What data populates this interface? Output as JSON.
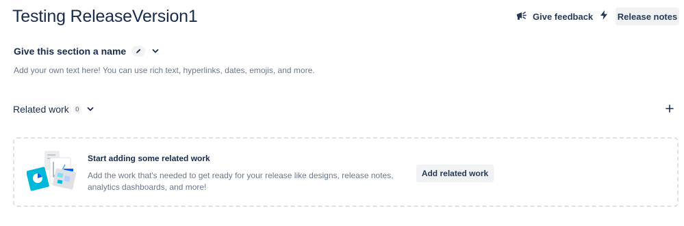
{
  "header": {
    "title": "Testing ReleaseVersion1",
    "feedback_label": "Give feedback",
    "release_notes_label": "Release notes"
  },
  "custom_section": {
    "name": "Give this section a name",
    "description": "Add your own text here! You can use rich text, hyperlinks, dates, emojis, and more."
  },
  "related_work": {
    "title": "Related work",
    "count": "0",
    "empty_title": "Start adding some related work",
    "empty_body": "Add the work that's needed to get ready for your release like designs, release notes, analytics dashboards, and more!",
    "add_label": "Add related work"
  },
  "icons": {
    "feedback": "megaphone-icon",
    "bolt": "lightning-bolt-icon",
    "edit": "pencil-icon",
    "chevron": "chevron-down-icon",
    "add": "plus-icon"
  },
  "colors": {
    "text": "#172b4d",
    "subtle_text": "#6b778c",
    "button_bg": "#f1f2f4",
    "illustration_teal": "#00b8d9",
    "illustration_blue": "#0065ff"
  }
}
